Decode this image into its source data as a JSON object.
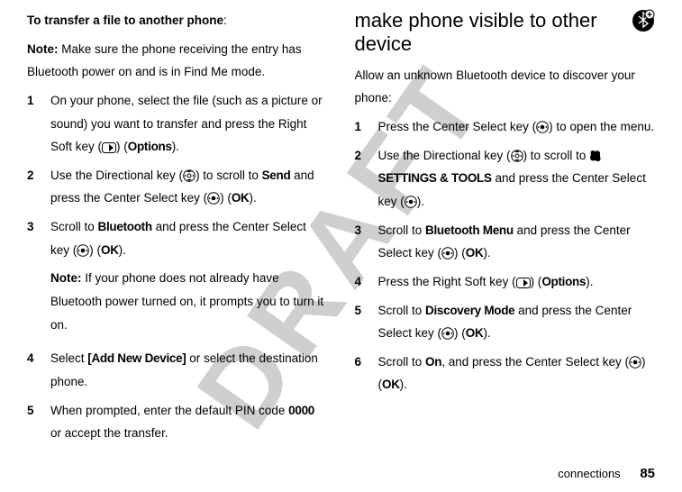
{
  "watermark": "DRAFT",
  "left": {
    "intro": "To transfer a file to another phone",
    "intro_colon": ":",
    "note_label": "Note:",
    "note_text": " Make sure the phone receiving the entry has Bluetooth power on and is in Find Me mode.",
    "steps": [
      {
        "num": "1",
        "parts": [
          {
            "t": "On your phone, select the file (such as a picture or sound) you want to transfer and press the Right Soft key ("
          },
          {
            "icon": "soft-right"
          },
          {
            "t": ") ("
          },
          {
            "c": "Options"
          },
          {
            "t": ")."
          }
        ]
      },
      {
        "num": "2",
        "parts": [
          {
            "t": "Use the Directional key ("
          },
          {
            "icon": "dir"
          },
          {
            "t": ") to scroll to "
          },
          {
            "c": "Send"
          },
          {
            "t": " and press the Center Select key ("
          },
          {
            "icon": "center"
          },
          {
            "t": ") ("
          },
          {
            "c": "OK"
          },
          {
            "t": ")."
          }
        ]
      },
      {
        "num": "3",
        "parts": [
          {
            "t": "Scroll to "
          },
          {
            "c": "Bluetooth"
          },
          {
            "t": " and press the Center Select key ("
          },
          {
            "icon": "center"
          },
          {
            "t": ") ("
          },
          {
            "c": "OK"
          },
          {
            "t": ")."
          }
        ],
        "note_label": "Note:",
        "note_text": " If your phone does not already have Bluetooth power turned on, it prompts you to turn it on."
      },
      {
        "num": "4",
        "parts": [
          {
            "t": "Select "
          },
          {
            "c": "[Add New Device]"
          },
          {
            "t": " or select the destination phone."
          }
        ]
      },
      {
        "num": "5",
        "parts": [
          {
            "t": "When prompted, enter the default PIN code "
          },
          {
            "c": "0000"
          },
          {
            "t": " or accept the transfer."
          }
        ]
      }
    ]
  },
  "right": {
    "heading": "make phone visible to other device",
    "intro": "Allow an unknown Bluetooth device to discover your phone:",
    "steps": [
      {
        "num": "1",
        "parts": [
          {
            "t": "Press the Center Select key ("
          },
          {
            "icon": "center"
          },
          {
            "t": ") to open the menu."
          }
        ]
      },
      {
        "num": "2",
        "parts": [
          {
            "t": "Use the Directional key ("
          },
          {
            "icon": "dir"
          },
          {
            "t": ") to scroll to "
          },
          {
            "icon": "settings"
          },
          {
            "c": "SETTINGS & TOOLS"
          },
          {
            "t": " and press the Center Select key ("
          },
          {
            "icon": "center"
          },
          {
            "t": ")."
          }
        ]
      },
      {
        "num": "3",
        "parts": [
          {
            "t": "Scroll to "
          },
          {
            "c": "Bluetooth Menu"
          },
          {
            "t": " and press the Center Select key ("
          },
          {
            "icon": "center"
          },
          {
            "t": ") ("
          },
          {
            "c": "OK"
          },
          {
            "t": ")."
          }
        ]
      },
      {
        "num": "4",
        "parts": [
          {
            "t": "Press the Right Soft key ("
          },
          {
            "icon": "soft-right"
          },
          {
            "t": ") ("
          },
          {
            "c": "Options"
          },
          {
            "t": ")."
          }
        ]
      },
      {
        "num": "5",
        "parts": [
          {
            "t": "Scroll to "
          },
          {
            "c": "Discovery Mode"
          },
          {
            "t": " and press the Center Select key ("
          },
          {
            "icon": "center"
          },
          {
            "t": ") ("
          },
          {
            "c": "OK"
          },
          {
            "t": ")."
          }
        ]
      },
      {
        "num": "6",
        "parts": [
          {
            "t": "Scroll to "
          },
          {
            "c": "On"
          },
          {
            "t": ", and press the Center Select key ("
          },
          {
            "icon": "center"
          },
          {
            "t": ") ("
          },
          {
            "c": "OK"
          },
          {
            "t": ")."
          }
        ]
      }
    ]
  },
  "footer": {
    "section": "connections",
    "page": "85"
  }
}
